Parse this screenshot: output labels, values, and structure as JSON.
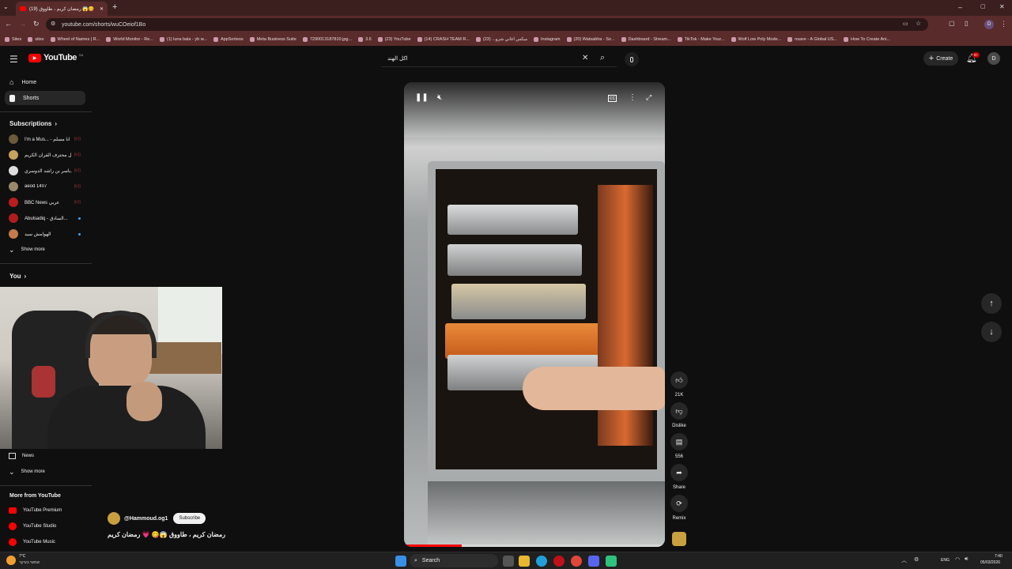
{
  "browser": {
    "tab_title": "(19) رمضان كريم ، طاووق 😱😋",
    "url": "youtube.com/shorts/wuCOeiof1Bo",
    "profile_initial": "D",
    "bookmarks": [
      "Sites",
      "sites",
      "Wheel of Names | R...",
      "World Monitor - Re...",
      "(1) luna bala - yb w...",
      "AppSorteos",
      "Meta Business Suite",
      "7290013187810.jpg...",
      "3.6",
      "(23) YouTube",
      "(14) CRASH TEAM R...",
      "ميكس اغاني شرو... (23)",
      "Instagram",
      "(20) Watsabha - So...",
      "Dashboard - Stream...",
      "TikTok - Make Your...",
      "Wolf Low Poly Mode...",
      "nsave - A Global US...",
      "How To Create Ani..."
    ]
  },
  "youtube": {
    "logo_text": "YouTube",
    "logo_sup": "SA",
    "search_value": "اكل الهند",
    "create_label": "Create",
    "notif_count": "9+",
    "user_initial": "D"
  },
  "sidebar": {
    "home": "Home",
    "shorts": "Shorts",
    "subscriptions": "Subscriptions",
    "channels": [
      {
        "name": "I'm a Mus... - انا مسلم",
        "color": "#6b5b3a",
        "dot": "live"
      },
      {
        "name": "ل محترف القرآن الكريم...",
        "color": "#c8a060",
        "dot": "live"
      },
      {
        "name": "ياسر بن راشد الدوسري...",
        "color": "#ddd",
        "dot": "live"
      },
      {
        "name": "aeod 1407",
        "color": "#9a8a6a",
        "dot": "live"
      },
      {
        "name": "BBC News عربي",
        "color": "#b81c1c",
        "dot": "live"
      },
      {
        "name": "Abulsadiq - السادق...",
        "color": "#b01c1c",
        "dot": "new"
      },
      {
        "name": "الهوامش سيد",
        "color": "#c47a4a",
        "dot": "new"
      }
    ],
    "show_more": "Show more",
    "you": "You",
    "news": "News",
    "show_more_2": "Show more",
    "more_from_youtube": "More from YouTube",
    "premium": "YouTube Premium",
    "studio": "YouTube Studio",
    "music": "YouTube Music"
  },
  "short": {
    "channel": "@Hammoud.og1",
    "subscribe": "Subscribe",
    "caption": "رمضان كريم ، طاووق 😱😋 💗 رمضان كريم",
    "likes": "21K",
    "dislike": "Dislike",
    "comments": "556",
    "share": "Share",
    "remix": "Remix"
  },
  "taskbar": {
    "weather_temp": "7°C",
    "weather_desc": "שמשי בעיקר",
    "search": "Search",
    "lang": "ENG",
    "time": "7:40",
    "date": "05/03/2026"
  },
  "colors": {
    "youtube_red": "#ff0000",
    "browser_bar": "#5a2b2b",
    "background": "#0f0f0f"
  }
}
